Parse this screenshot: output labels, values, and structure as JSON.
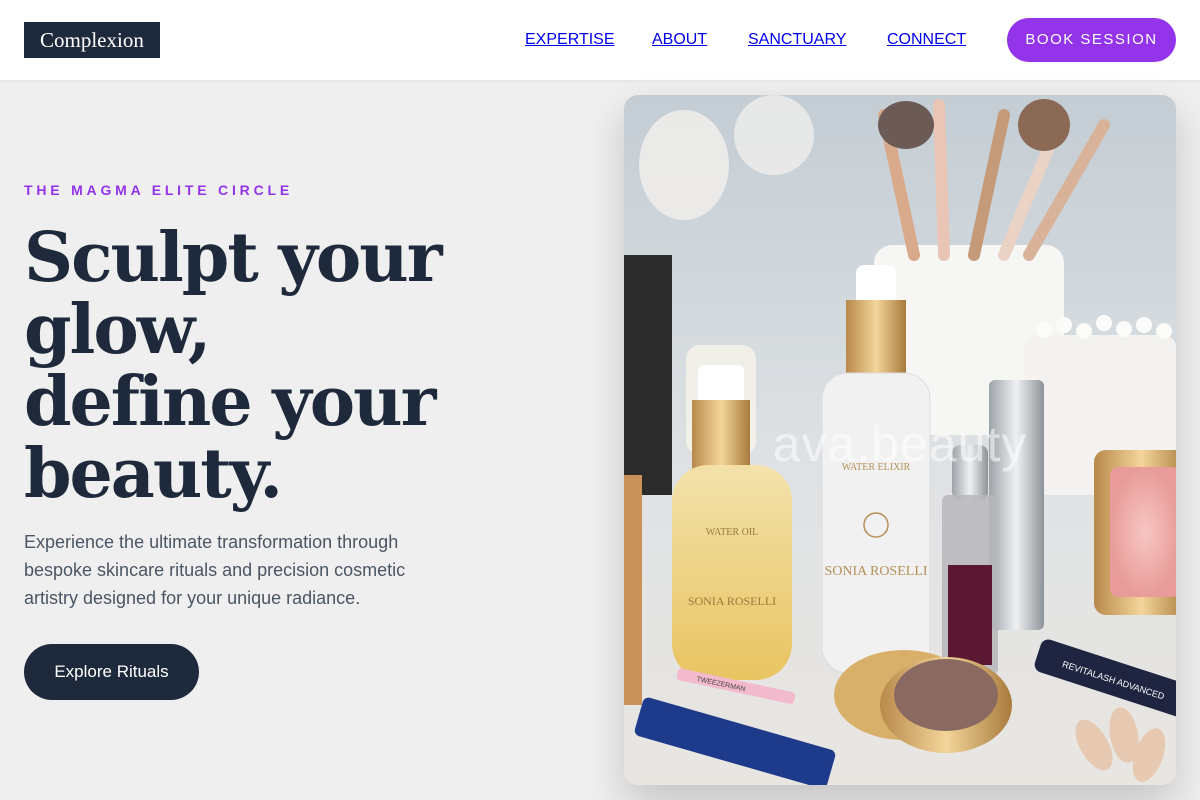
{
  "brand": {
    "logo_text": "Complexion"
  },
  "nav": {
    "items": [
      {
        "label": "EXPERTISE"
      },
      {
        "label": "ABOUT"
      },
      {
        "label": "SANCTUARY"
      },
      {
        "label": "CONNECT"
      }
    ],
    "cta_label": "BOOK SESSION"
  },
  "hero": {
    "kicker": "THE MAGMA ELITE CIRCLE",
    "headline_lines": [
      "Sculpt your",
      "glow,",
      "define your",
      "beauty."
    ],
    "lede": "Experience the ultimate transformation through bespoke skincare rituals and precision cosmetic artistry designed for your unique radiance.",
    "cta_label": "Explore Rituals"
  },
  "photo": {
    "watermark": "ava.beauty",
    "bottle_brand": "SONIA ROSELLI",
    "bottle_left_label": "WATER OIL",
    "bottle_right_label": "WATER ELIXIR",
    "tube_label": "REVITALASH ADVANCED",
    "tweezer_label": "TWEEZERMAN"
  },
  "colors": {
    "accent": "#9333ea",
    "navy": "#1e293b",
    "background": "#efefef"
  }
}
